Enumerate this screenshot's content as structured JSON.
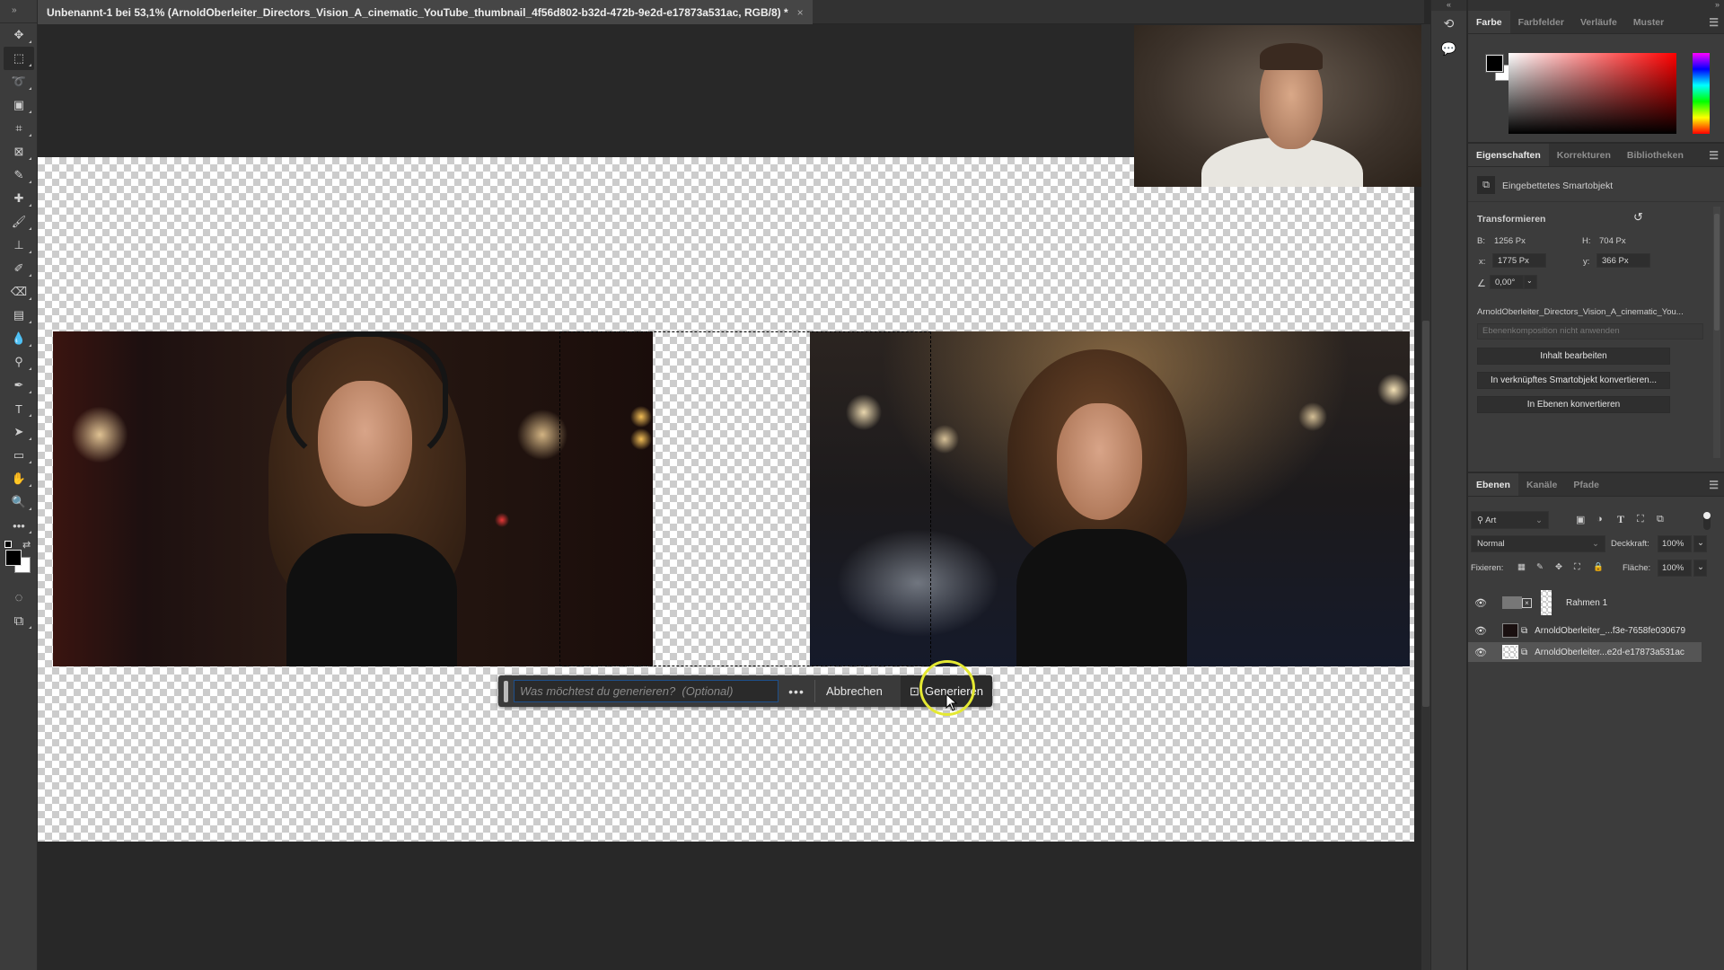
{
  "document_tab": {
    "title": "Unbenannt-1 bei 53,1% (ArnoldOberleiter_Directors_Vision_A_cinematic_YouTube_thumbnail_4f56d802-b32d-472b-9e2d-e17873a531ac, RGB/8) *",
    "close_icon": "×"
  },
  "toolbar": {
    "collapse": "»",
    "tools": [
      {
        "name": "move-tool",
        "glyph": "✥"
      },
      {
        "name": "rectangular-marquee-tool",
        "glyph": "⬚",
        "active": true
      },
      {
        "name": "lasso-tool",
        "glyph": "➰"
      },
      {
        "name": "object-selection-tool",
        "glyph": "▣"
      },
      {
        "name": "crop-tool",
        "glyph": "⌗"
      },
      {
        "name": "frame-tool",
        "glyph": "⊠"
      },
      {
        "name": "eyedropper-tool",
        "glyph": "✎"
      },
      {
        "name": "spot-healing-brush-tool",
        "glyph": "✚"
      },
      {
        "name": "brush-tool",
        "glyph": "🖌"
      },
      {
        "name": "clone-stamp-tool",
        "glyph": "⊥"
      },
      {
        "name": "history-brush-tool",
        "glyph": "✐"
      },
      {
        "name": "eraser-tool",
        "glyph": "⌫"
      },
      {
        "name": "gradient-tool",
        "glyph": "▤"
      },
      {
        "name": "blur-tool",
        "glyph": "💧"
      },
      {
        "name": "dodge-tool",
        "glyph": "⚲"
      },
      {
        "name": "pen-tool",
        "glyph": "✒"
      },
      {
        "name": "type-tool",
        "glyph": "T"
      },
      {
        "name": "path-selection-tool",
        "glyph": "➤"
      },
      {
        "name": "rectangle-tool",
        "glyph": "▭"
      },
      {
        "name": "hand-tool",
        "glyph": "✋"
      },
      {
        "name": "zoom-tool",
        "glyph": "🔍"
      },
      {
        "name": "edit-toolbar",
        "glyph": "•••"
      }
    ],
    "foreground_color": "#000000",
    "background_color": "#ffffff",
    "quick_mask": "◌",
    "screen_mode": "⧉"
  },
  "generative_bar": {
    "placeholder": "Was möchtest du generieren?  (Optional)",
    "value": "",
    "more_label": "•••",
    "cancel_label": "Abbrechen",
    "generate_label": "Generieren",
    "generate_icon": "⊡"
  },
  "icon_strip": {
    "collapse": "«",
    "history_icon": "⟲",
    "comments_icon": "💬"
  },
  "color_panel": {
    "expand": "»",
    "tabs": [
      "Farbe",
      "Farbfelder",
      "Verläufe",
      "Muster"
    ],
    "active_tab": "Farbe",
    "foreground": "#000000",
    "background": "#ffffff",
    "hue_color": "#ff0000"
  },
  "properties_panel": {
    "tabs": [
      "Eigenschaften",
      "Korrekturen",
      "Bibliotheken"
    ],
    "active_tab": "Eigenschaften",
    "object_type": "Eingebettetes Smartobjekt",
    "transform_heading": "Transformieren",
    "w_label": "B:",
    "w_value": "1256 Px",
    "h_label": "H:",
    "h_value": "704 Px",
    "x_label": "x:",
    "x_value": "1775 Px",
    "y_label": "y:",
    "y_value": "366 Px",
    "angle_value": "0,00°",
    "source_name": "ArnoldOberleiter_Directors_Vision_A_cinematic_You...",
    "layer_comp_placeholder": "Ebenenkomposition nicht anwenden",
    "buttons": [
      "Inhalt bearbeiten",
      "In verknüpftes Smartobjekt konvertieren...",
      "In Ebenen konvertieren"
    ]
  },
  "layers_panel": {
    "tabs": [
      "Ebenen",
      "Kanäle",
      "Pfade"
    ],
    "active_tab": "Ebenen",
    "filter_label": "Art",
    "blend_mode": "Normal",
    "opacity_label": "Deckkraft:",
    "opacity_value": "100%",
    "lock_label": "Fixieren:",
    "fill_label": "Fläche:",
    "fill_value": "100%",
    "layers": [
      {
        "name": "Rahmen 1",
        "visible": true,
        "selected": false
      },
      {
        "name": "ArnoldOberleiter_...f3e-7658fe030679",
        "visible": true,
        "selected": false
      },
      {
        "name": "ArnoldOberleiter...e2d-e17873a531ac",
        "visible": true,
        "selected": true
      }
    ]
  }
}
